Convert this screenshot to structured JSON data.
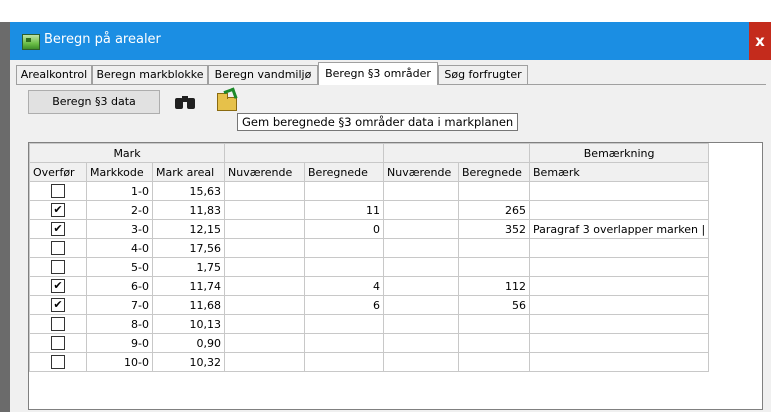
{
  "window": {
    "title": "Beregn på arealer",
    "close_label": "x"
  },
  "tabs": [
    {
      "label": "Arealkontrol"
    },
    {
      "label": "Beregn markblokke"
    },
    {
      "label": "Beregn vandmiljø"
    },
    {
      "label": "Beregn §3 områder"
    },
    {
      "label": "Søg forfrugter"
    }
  ],
  "active_tab": 3,
  "toolbar": {
    "calc_button": "Beregn §3 data",
    "binoculars_icon": "binoculars-icon",
    "folder_icon": "open-folder-icon"
  },
  "grid": {
    "group_headers": {
      "mark": "Mark",
      "group2": "",
      "group3": "",
      "remark": "Bemærkning"
    },
    "columns": [
      "Overfør",
      "Markkode",
      "Mark areal",
      "Nuværende",
      "Beregnede",
      "Nuværende",
      "Beregnede",
      "Bemærk"
    ],
    "rows": [
      {
        "checked": false,
        "check_mark": "",
        "code": "1-0",
        "area": "15,63",
        "cur1": "",
        "calc1": "",
        "cur2": "",
        "calc2": "",
        "remark": ""
      },
      {
        "checked": true,
        "check_mark": "✔",
        "code": "2-0",
        "area": "11,83",
        "cur1": "",
        "calc1": "11",
        "cur2": "",
        "calc2": "265",
        "remark": ""
      },
      {
        "checked": true,
        "check_mark": "✔",
        "code": "3-0",
        "area": "12,15",
        "cur1": "",
        "calc1": "0",
        "cur2": "",
        "calc2": "352",
        "remark": "Paragraf 3 overlapper marken |"
      },
      {
        "checked": false,
        "check_mark": "",
        "code": "4-0",
        "area": "17,56",
        "cur1": "",
        "calc1": "",
        "cur2": "",
        "calc2": "",
        "remark": ""
      },
      {
        "checked": false,
        "check_mark": "",
        "code": "5-0",
        "area": "1,75",
        "cur1": "",
        "calc1": "",
        "cur2": "",
        "calc2": "",
        "remark": ""
      },
      {
        "checked": true,
        "check_mark": "✔",
        "code": "6-0",
        "area": "11,74",
        "cur1": "",
        "calc1": "4",
        "cur2": "",
        "calc2": "112",
        "remark": ""
      },
      {
        "checked": true,
        "check_mark": "✔",
        "code": "7-0",
        "area": "11,68",
        "cur1": "",
        "calc1": "6",
        "cur2": "",
        "calc2": "56",
        "remark": ""
      },
      {
        "checked": false,
        "check_mark": "",
        "code": "8-0",
        "area": "10,13",
        "cur1": "",
        "calc1": "",
        "cur2": "",
        "calc2": "",
        "remark": ""
      },
      {
        "checked": false,
        "check_mark": "",
        "code": "9-0",
        "area": "0,90",
        "cur1": "",
        "calc1": "",
        "cur2": "",
        "calc2": "",
        "remark": ""
      },
      {
        "checked": false,
        "check_mark": "",
        "code": "10-0",
        "area": "10,32",
        "cur1": "",
        "calc1": "",
        "cur2": "",
        "calc2": "",
        "remark": ""
      }
    ]
  },
  "tooltip": "Gem beregnede §3 områder data i markplanen",
  "colors": {
    "titlebar": "#1b8ee3",
    "close": "#c42b1c",
    "panel": "#f0f0f0"
  }
}
